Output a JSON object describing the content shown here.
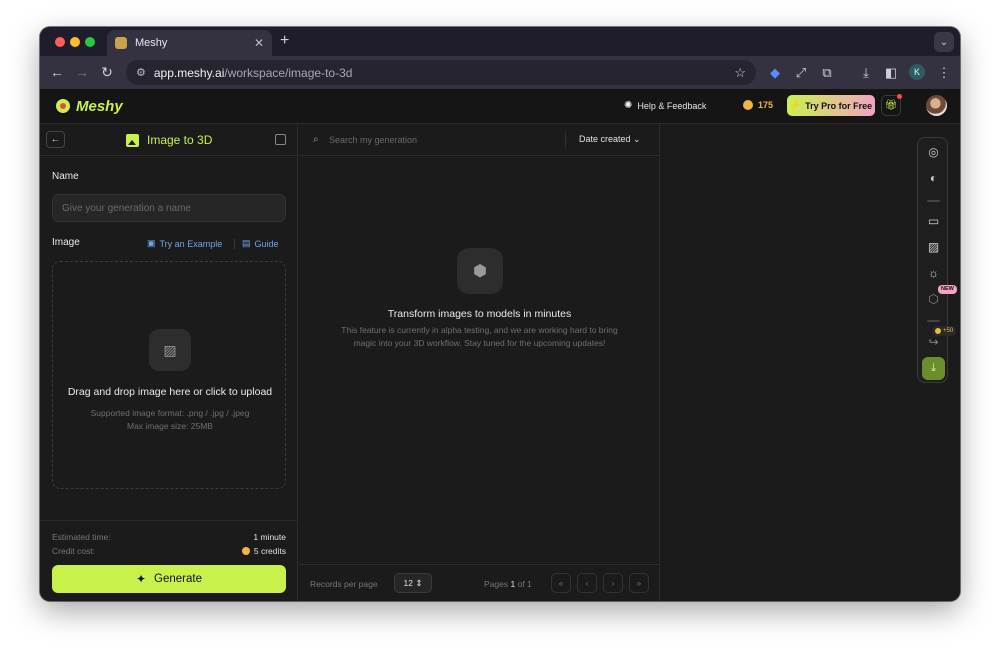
{
  "browser": {
    "tab_title": "Meshy",
    "url_host": "app.meshy.ai",
    "url_path": "/workspace/image-to-3d",
    "profile_initial": "K"
  },
  "header": {
    "logo_text": "Meshy",
    "help_label": "Help & Feedback",
    "credits": "175",
    "try_pro_label": "Try Pro for Free"
  },
  "left_panel": {
    "title": "Image to 3D",
    "name_label": "Name",
    "name_placeholder": "Give your generation a name",
    "image_label": "Image",
    "try_example_label": "Try an Example",
    "guide_label": "Guide",
    "upload_title": "Drag and drop image here or click to upload",
    "upload_formats": "Supported image format: .png / .jpg / .jpeg",
    "upload_max_size": "Max image size: 25MB",
    "estimated_time_label": "Estimated time:",
    "estimated_time_value": "1 minute",
    "credit_cost_label": "Credit cost:",
    "credit_cost_value": "5 credits",
    "generate_label": "Generate"
  },
  "middle_panel": {
    "search_placeholder": "Search my generation",
    "sort_label": "Date created",
    "empty_title": "Transform images to models in minutes",
    "empty_description": "This feature is currently in alpha testing, and we are working hard to bring magic into your 3D workflow. Stay tuned for the upcoming updates!",
    "records_per_page_label": "Records per page",
    "records_per_page_value": "12",
    "pages_prefix": "Pages",
    "page_current": "1",
    "pages_of": "of 1"
  },
  "viewer_toolbar": {
    "new_badge": "NEW",
    "reward_badge": "+50"
  },
  "colors": {
    "accent": "#c9f14c",
    "background": "#1b1b1b",
    "link": "#6fa6e8",
    "coin": "#f0b545"
  }
}
